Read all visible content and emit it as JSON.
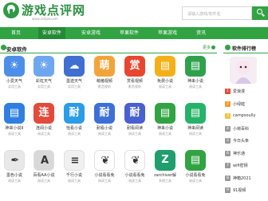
{
  "header": {
    "logo_text": "游戏点评网",
    "url": "www.zsdpw.com",
    "search_placeholder": "请输入游戏/软件名",
    "accent": "#31a343"
  },
  "nav": {
    "items": [
      "首页",
      "安卓软件",
      "安卓游戏",
      "苹果软件",
      "苹果游戏",
      "资讯"
    ]
  },
  "section": {
    "title": "安卓软件",
    "more": "更多"
  },
  "apps": [
    {
      "name": "小爱天气",
      "meta": "实用工具",
      "icon": "weather-icon",
      "color": "#4d8fe8"
    },
    {
      "name": "彩虹天气",
      "meta": "实用工具",
      "icon": "weather-icon",
      "color": "#6ea7f0"
    },
    {
      "name": "墨迹天气",
      "meta": "实用工具",
      "icon": "cloud-icon",
      "color": "#3f6fd0"
    },
    {
      "name": "萌猪视频",
      "meta": "影音视听",
      "icon": "pig-icon",
      "color": "#f2a43a"
    },
    {
      "name": "赏看视频",
      "meta": "影音视听",
      "icon": "reward-icon",
      "color": "#e8462f"
    },
    {
      "name": "免费小说",
      "meta": "阅读工具",
      "icon": "book-icon",
      "color": "#f4b019"
    },
    {
      "name": "神来小说",
      "meta": "阅读工具",
      "icon": "book-icon",
      "color": "#2fa14c"
    },
    {
      "name": "神来小说II",
      "meta": "阅读工具",
      "icon": "book-icon",
      "color": "#2f7fe0"
    },
    {
      "name": "连阅小说",
      "meta": "阅读工具",
      "icon": "link-icon",
      "color": "#e24b3b"
    },
    {
      "name": "恰看小说",
      "meta": "阅读工具",
      "icon": "read-icon",
      "color": "#2b9ce6"
    },
    {
      "name": "耐看小说",
      "meta": "阅读工具",
      "icon": "read-icon",
      "color": "#3d6fd8"
    },
    {
      "name": "耐看阅读",
      "meta": "阅读工具",
      "icon": "read-icon",
      "color": "#4a5fd0"
    },
    {
      "name": "神来小说",
      "meta": "阅读工具",
      "icon": "book-icon",
      "color": "#31a343"
    },
    {
      "name": "神来阅读",
      "meta": "阅读工具",
      "icon": "book-icon",
      "color": "#27b26a"
    },
    {
      "name": "墨色小说",
      "meta": "阅读工具",
      "icon": "ink-icon",
      "color": "#e8e8e8"
    },
    {
      "name": "百看AA小说",
      "meta": "阅读工具",
      "icon": "text-icon",
      "color": "#d8d8d8"
    },
    {
      "name": "千行小说",
      "meta": "阅读工具",
      "icon": "scroll-icon",
      "color": "#f0f0f0"
    },
    {
      "name": "小说看看免",
      "meta": "阅读工具",
      "icon": "feather-icon",
      "color": "#ffffff"
    },
    {
      "name": "小说看看免",
      "meta": "阅读工具",
      "icon": "feather-icon",
      "color": "#ffffff"
    },
    {
      "name": "zarchiver解",
      "meta": "系统工具",
      "icon": "archive-icon",
      "color": "#1f9e6e"
    },
    {
      "name": "小说看看免",
      "meta": "阅读工具",
      "icon": "book-icon",
      "color": "#31a343"
    }
  ],
  "sidebar": {
    "title": "软件排行榜",
    "items": [
      {
        "num": "1",
        "name": "爱浪漫",
        "color": "#e24b3b"
      },
      {
        "num": "2",
        "name": "小绿蛙",
        "color": "#f29a2b"
      },
      {
        "num": "3",
        "name": "campsoully",
        "color": "#f4c23a"
      },
      {
        "num": "4",
        "name": "小荷百科",
        "color": "#999999"
      },
      {
        "num": "5",
        "name": "今日头条",
        "color": "#999999"
      },
      {
        "num": "6",
        "name": "神乐通",
        "color": "#999999"
      },
      {
        "num": "7",
        "name": "wifi密钥",
        "color": "#999999"
      },
      {
        "num": "8",
        "name": "神箱2021",
        "color": "#999999"
      },
      {
        "num": "9",
        "name": "91视频",
        "color": "#999999"
      }
    ]
  }
}
